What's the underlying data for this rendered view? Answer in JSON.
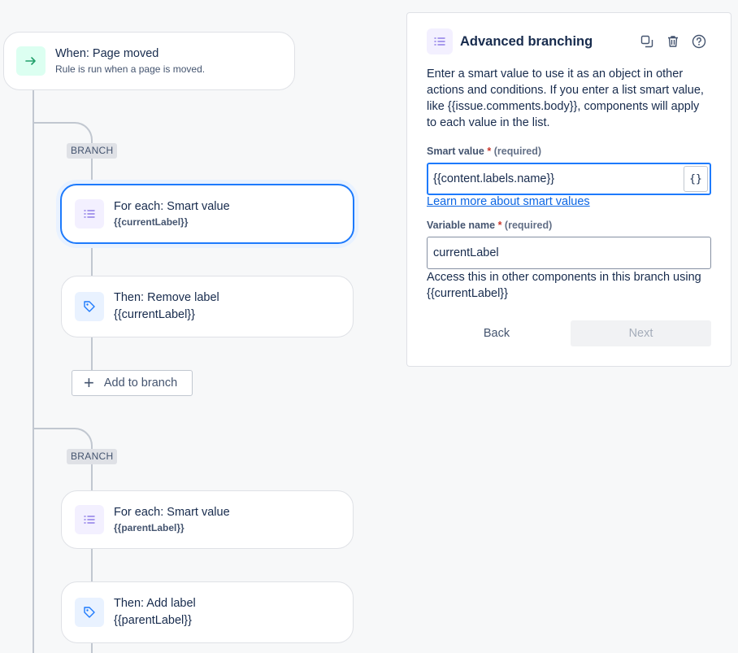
{
  "trigger": {
    "title": "When: Page moved",
    "subtitle": "Rule is run when a page is moved.",
    "icon": "arrow-right-icon"
  },
  "branches": [
    {
      "tag": "BRANCH",
      "for_each": {
        "title": "For each: Smart value",
        "value": "{{currentLabel}}",
        "icon": "list-icon"
      },
      "action": {
        "title": "Then: Remove label",
        "value": "{{currentLabel}}",
        "icon": "tag-icon"
      },
      "add_label": "Add to branch"
    },
    {
      "tag": "BRANCH",
      "for_each": {
        "title": "For each: Smart value",
        "value": "{{parentLabel}}",
        "icon": "list-icon"
      },
      "action": {
        "title": "Then: Add label",
        "value": "{{parentLabel}}",
        "icon": "tag-icon"
      }
    }
  ],
  "panel": {
    "title": "Advanced branching",
    "description": "Enter a smart value to use it as an object in other actions and conditions. If you enter a list smart value, like {{issue.comments.body}}, components will apply to each value in the list.",
    "smart_value": {
      "label": "Smart value",
      "required_mark": "*",
      "required_text": "(required)",
      "value": "{{content.labels.name}}",
      "button": "{}"
    },
    "learn_more": "Learn more about smart values",
    "variable_name": {
      "label": "Variable name",
      "required_mark": "*",
      "required_text": "(required)",
      "value": "currentLabel"
    },
    "hint": "Access this in other components in this branch using {{currentLabel}}",
    "back_label": "Back",
    "next_label": "Next"
  },
  "colors": {
    "accent": "#1d7afc",
    "trigger_icon": "#22a06b",
    "list_icon": "#8f7ee7",
    "tag_icon": "#1d7afc"
  }
}
